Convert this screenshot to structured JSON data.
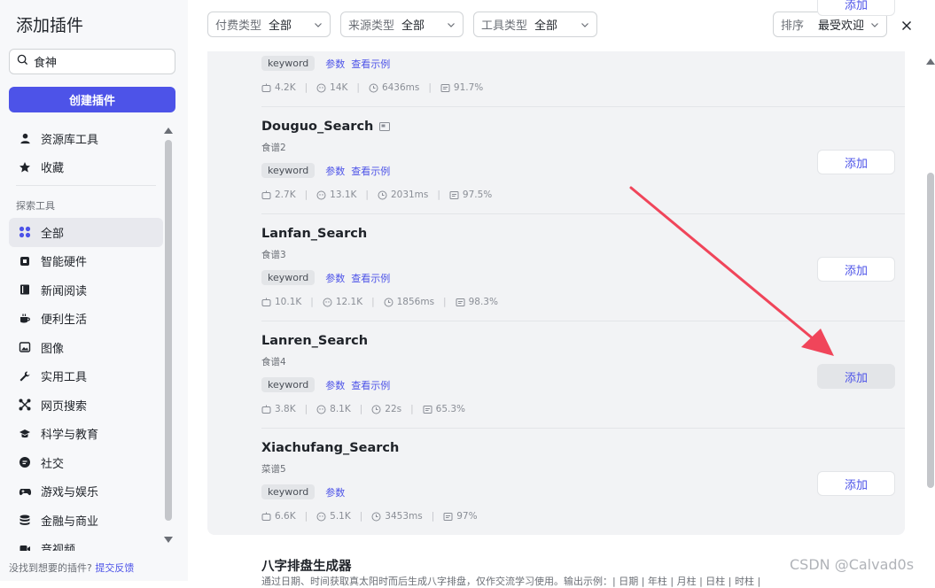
{
  "sidebar": {
    "title": "添加插件",
    "search_value": "食神",
    "create_button": "创建插件",
    "items_top": [
      {
        "label": "资源库工具",
        "icon": "user-icon"
      },
      {
        "label": "收藏",
        "icon": "star-icon"
      }
    ],
    "section_label": "探索工具",
    "items": [
      {
        "label": "全部",
        "icon": "grid-icon",
        "active": true
      },
      {
        "label": "智能硬件",
        "icon": "chip-icon"
      },
      {
        "label": "新闻阅读",
        "icon": "book-icon"
      },
      {
        "label": "便利生活",
        "icon": "cup-icon"
      },
      {
        "label": "图像",
        "icon": "image-icon"
      },
      {
        "label": "实用工具",
        "icon": "wrench-icon"
      },
      {
        "label": "网页搜索",
        "icon": "network-icon"
      },
      {
        "label": "科学与教育",
        "icon": "graduation-icon"
      },
      {
        "label": "社交",
        "icon": "chat-icon"
      },
      {
        "label": "游戏与娱乐",
        "icon": "gamepad-icon"
      },
      {
        "label": "金融与商业",
        "icon": "coins-icon"
      },
      {
        "label": "音视频",
        "icon": "video-icon"
      }
    ],
    "footer_text": "没找到想要的插件?",
    "footer_link": "提交反馈"
  },
  "filters": {
    "pay_label": "付费类型",
    "pay_value": "全部",
    "source_label": "来源类型",
    "source_value": "全部",
    "tool_label": "工具类型",
    "tool_value": "全部",
    "sort_label": "排序",
    "sort_value": "最受欢迎"
  },
  "cards": [
    {
      "name": "",
      "desc": "",
      "tag": "keyword",
      "params": "参数",
      "example": "查看示例",
      "stats": [
        "4.2K",
        "14K",
        "6436ms",
        "91.7%"
      ],
      "add": "添加"
    },
    {
      "name": "Douguo_Search",
      "desc": "食谱2",
      "tag": "keyword",
      "params": "参数",
      "example": "查看示例",
      "stats": [
        "2.7K",
        "13.1K",
        "2031ms",
        "97.5%"
      ],
      "add": "添加"
    },
    {
      "name": "Lanfan_Search",
      "desc": "食谱3",
      "tag": "keyword",
      "params": "参数",
      "example": "查看示例",
      "stats": [
        "10.1K",
        "12.1K",
        "1856ms",
        "98.3%"
      ],
      "add": "添加"
    },
    {
      "name": "Lanren_Search",
      "desc": "食谱4",
      "tag": "keyword",
      "params": "参数",
      "example": "查看示例",
      "stats": [
        "3.8K",
        "8.1K",
        "22s",
        "65.3%"
      ],
      "add": "添加"
    },
    {
      "name": "Xiachufang_Search",
      "desc": "菜谱5",
      "tag": "keyword",
      "params": "参数",
      "example": "",
      "stats": [
        "6.6K",
        "5.1K",
        "3453ms",
        "97%"
      ],
      "add": "添加"
    }
  ],
  "bottom": {
    "name": "八字排盘生成器",
    "desc": "通过日期、时间获取真太阳时而后生成八字排盘，仅作交流学习使用。输出示例：| 日期 | 年柱 | 月柱 | 日柱 | 时柱 |"
  },
  "watermark": "CSDN @Calvad0s",
  "colors": {
    "accent": "#4d53e8",
    "arrow": "#f0455a"
  }
}
